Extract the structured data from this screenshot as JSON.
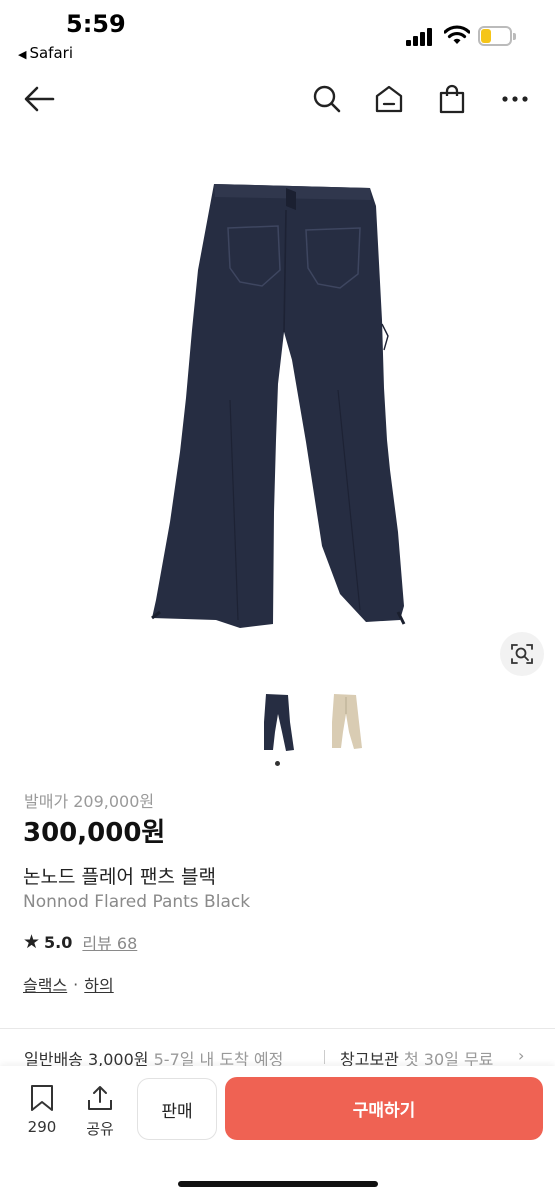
{
  "status": {
    "time": "5:59",
    "back_app": "Safari"
  },
  "nav": {
    "icons": [
      "back-arrow-icon",
      "search-icon",
      "home-icon",
      "shopping-bag-icon",
      "more-icon"
    ]
  },
  "product": {
    "release_price": "발매가 209,000원",
    "price": "300,000원",
    "name_ko": "논노드 플레어 팬츠 블랙",
    "name_en": "Nonnod Flared Pants Black",
    "rating": "5.0",
    "review_label": "리뷰 68",
    "categories": [
      "슬랙스",
      "하의"
    ],
    "category_separator": "·",
    "thumbnails": [
      "navy flared pants",
      "beige flared pants"
    ]
  },
  "shipping": {
    "label": "일반배송",
    "fee": "3,000원",
    "eta": "5-7일 내 도착 예정",
    "storage_label": "창고보관",
    "storage_note": "첫 30일 무료"
  },
  "bottom_bar": {
    "bookmark_count": "290",
    "share_label": "공유",
    "sell_label": "판매",
    "buy_label": "구매하기"
  },
  "colors": {
    "accent": "#ef6253",
    "pants_navy": "#262d42",
    "pants_beige": "#d9ccb3"
  }
}
